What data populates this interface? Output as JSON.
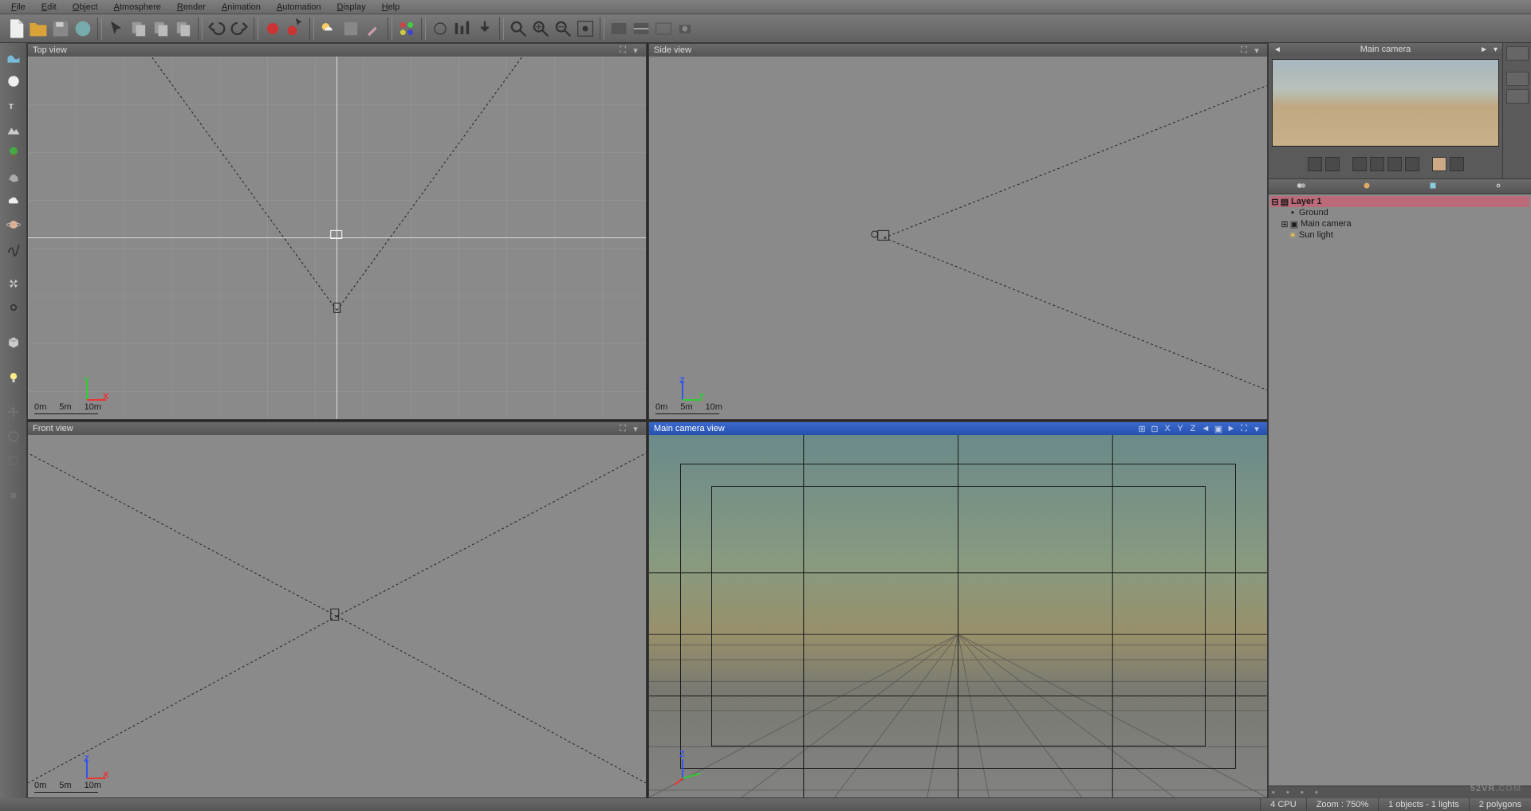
{
  "menu": [
    "File",
    "Edit",
    "Object",
    "Atmosphere",
    "Render",
    "Animation",
    "Automation",
    "Display",
    "Help"
  ],
  "viewports": {
    "top": {
      "title": "Top view",
      "axis1": "Y",
      "axis2": "X",
      "scales": [
        "0m",
        "5m",
        "10m"
      ]
    },
    "side": {
      "title": "Side view",
      "axis1": "Z",
      "axis2": "Y",
      "scales": [
        "0m",
        "5m",
        "10m"
      ]
    },
    "front": {
      "title": "Front view",
      "axis1": "Z",
      "axis2": "X",
      "scales": [
        "0m",
        "5m",
        "10m"
      ]
    },
    "cam": {
      "title": "Main camera view",
      "axis1": "Z",
      "axis2": "Y",
      "axis3": "X",
      "toolbar": [
        "X",
        "Y",
        "Z"
      ]
    }
  },
  "preview": {
    "title": "Main camera"
  },
  "tree": {
    "layer": "Layer 1",
    "items": [
      "Ground",
      "Main camera",
      "Sun light"
    ]
  },
  "status": {
    "cpu": "4 CPU",
    "zoom": "Zoom : 750%",
    "sel": "1 objects - 1 lights",
    "poly": "2 polygons"
  },
  "watermark1": "52VR",
  "watermark2": ".COM"
}
